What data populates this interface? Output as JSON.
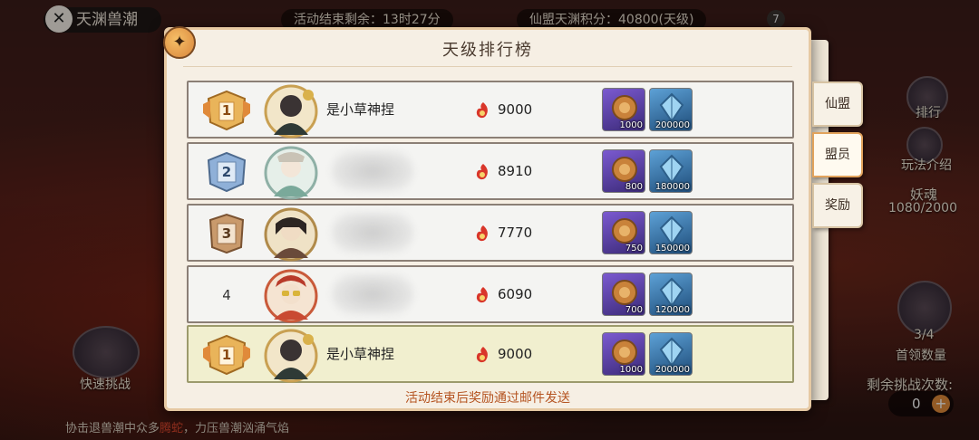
{
  "background": {
    "top_title": "天渊兽潮",
    "activity_countdown": "活动结束剩余：13时27分",
    "alliance_points": "仙盟天渊积分：40800(天级)",
    "top_badge": "7",
    "quick_challenge": "快速挑战",
    "ranking_label": "排行",
    "how_to_play": "玩法介绍",
    "soul_label": "妖魂",
    "soul_count": "1080/2000",
    "boss_progress": "3/4",
    "boss_count_label": "首领数量",
    "remaining_challenges_label": "剩余挑战次数:",
    "remaining_challenges": "0",
    "bottom_hint_a": "协击退兽潮中众多",
    "bottom_hint_red": "腾蛇",
    "bottom_hint_b": "，力压兽潮汹涌气焰"
  },
  "panel": {
    "title": "天级排行榜",
    "footer": "活动结束后奖励通过邮件发送",
    "tabs": [
      {
        "label": "仙盟"
      },
      {
        "label": "盟员"
      },
      {
        "label": "奖励"
      }
    ]
  },
  "rows": [
    {
      "rank": "1",
      "name": "是小草神捏",
      "score": "9000",
      "rewards": [
        "1000",
        "200000"
      ]
    },
    {
      "rank": "2",
      "name": "",
      "score": "8910",
      "rewards": [
        "800",
        "180000"
      ]
    },
    {
      "rank": "3",
      "name": "",
      "score": "7770",
      "rewards": [
        "750",
        "150000"
      ]
    },
    {
      "rank": "4",
      "name": "",
      "score": "6090",
      "rewards": [
        "700",
        "120000"
      ]
    }
  ],
  "self_row": {
    "rank": "1",
    "name": "是小草神捏",
    "score": "9000",
    "rewards": [
      "1000",
      "200000"
    ]
  },
  "colors": {
    "gold_medal": "#e9b45a",
    "silver_medal": "#8fb0d8",
    "bronze_medal": "#c99a6c",
    "self_row_bg": "#f1efcf",
    "footer_text": "#b55421"
  }
}
